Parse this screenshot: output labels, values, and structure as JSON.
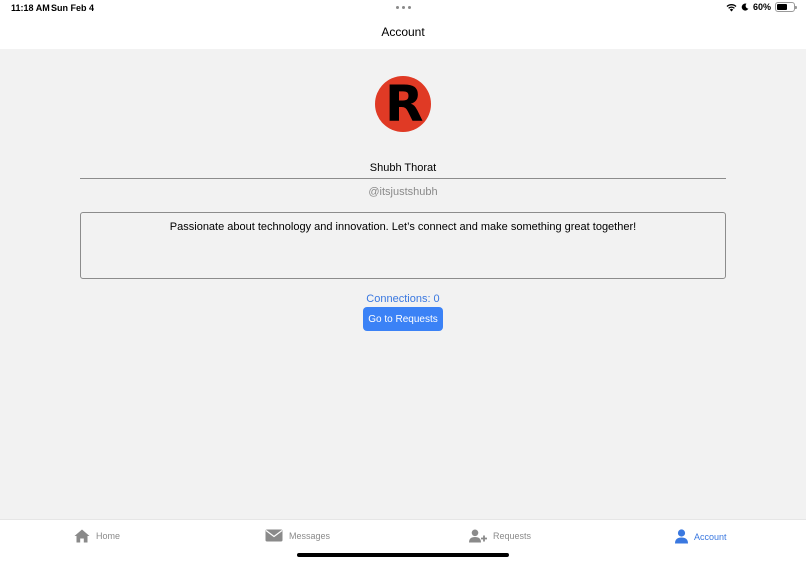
{
  "status_bar": {
    "time": "11:18 AM",
    "date": "Sun Feb 4",
    "battery": "60%",
    "battery_level": 0.6
  },
  "header": {
    "title": "Account"
  },
  "profile": {
    "avatar_letter": "R",
    "name": "Shubh Thorat",
    "handle": "@itsjustshubh",
    "bio": "Passionate about technology and innovation. Let’s connect and make something great together!",
    "connections_label": "Connections: 0",
    "requests_button": "Go to Requests"
  },
  "tabs": [
    {
      "label": "Home",
      "icon": "home-icon",
      "active": false
    },
    {
      "label": "Messages",
      "icon": "envelope-icon",
      "active": false
    },
    {
      "label": "Requests",
      "icon": "user-plus-icon",
      "active": false
    },
    {
      "label": "Account",
      "icon": "user-icon",
      "active": true
    }
  ],
  "colors": {
    "accent": "#3a78e0",
    "button": "#3b82f6",
    "avatar_bg": "#e03a25",
    "background": "#f2f2f2",
    "inactive": "#8a8a8a"
  }
}
